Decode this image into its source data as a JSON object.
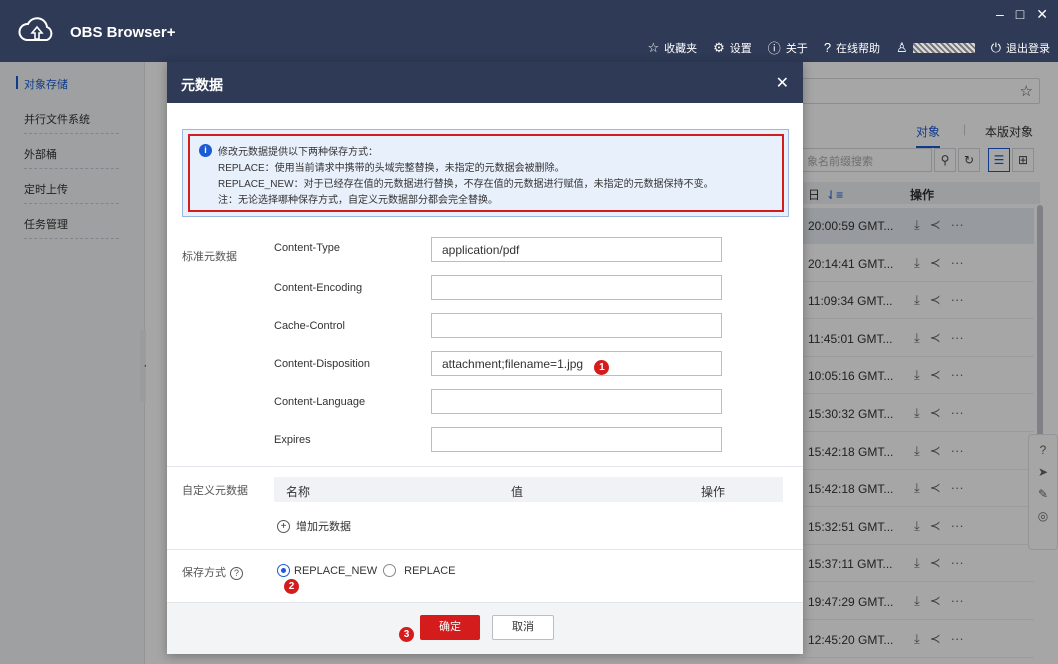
{
  "app": {
    "title": "OBS Browser+"
  },
  "window": {
    "minimize": "–",
    "maximize": "□",
    "close": "✕"
  },
  "topnav": {
    "favorites": "收藏夹",
    "settings": "设置",
    "about": "关于",
    "help": "在线帮助",
    "logout": "退出登录"
  },
  "sidebar": {
    "items": [
      {
        "label": "对象存储"
      },
      {
        "label": "并行文件系统"
      },
      {
        "label": "外部桶"
      },
      {
        "label": "定时上传"
      },
      {
        "label": "任务管理"
      }
    ]
  },
  "background": {
    "tabs": {
      "objects": "对象",
      "versions": "本版对象"
    },
    "search_placeholder": "象名前缀搜索",
    "table_header": {
      "modified": "日",
      "sort": "⇃≡",
      "ops": "操作"
    },
    "rows": [
      {
        "time": "20:00:59 GMT..."
      },
      {
        "time": "20:14:41 GMT..."
      },
      {
        "time": "11:09:34 GMT..."
      },
      {
        "time": "11:45:01 GMT..."
      },
      {
        "time": "10:05:16 GMT..."
      },
      {
        "time": "15:30:32 GMT..."
      },
      {
        "time": "15:42:18 GMT..."
      },
      {
        "time": "15:42:18 GMT..."
      },
      {
        "time": "15:32:51 GMT..."
      },
      {
        "time": "15:37:11 GMT..."
      },
      {
        "time": "19:47:29 GMT..."
      },
      {
        "time": "12:45:20 GMT..."
      }
    ],
    "row_more": "···"
  },
  "dialog": {
    "title": "元数据",
    "close": "✕",
    "notice": {
      "line1": "修改元数据提供以下两种保存方式：",
      "line2": "REPLACE：使用当前请求中携带的头域完整替换，未指定的元数据会被删除。",
      "line3": "REPLACE_NEW：对于已经存在值的元数据进行替换，不存在值的元数据进行赋值，未指定的元数据保持不变。",
      "line4": "注：无论选择哪种保存方式，自定义元数据部分都会完全替换。"
    },
    "standard_label": "标准元数据",
    "fields": [
      {
        "label": "Content-Type",
        "value": "application/pdf"
      },
      {
        "label": "Content-Encoding",
        "value": ""
      },
      {
        "label": "Cache-Control",
        "value": ""
      },
      {
        "label": "Content-Disposition",
        "value": "attachment;filename=1.jpg"
      },
      {
        "label": "Content-Language",
        "value": ""
      },
      {
        "label": "Expires",
        "value": ""
      }
    ],
    "custom_label": "自定义元数据",
    "custom_table": {
      "name": "名称",
      "value": "值",
      "ops": "操作"
    },
    "add_meta": "增加元数据",
    "save_mode_label": "保存方式",
    "save_modes": {
      "replace_new": "REPLACE_NEW",
      "replace": "REPLACE"
    },
    "ok": "确定",
    "cancel": "取消",
    "badges": {
      "b1": "1",
      "b2": "2",
      "b3": "3"
    }
  }
}
